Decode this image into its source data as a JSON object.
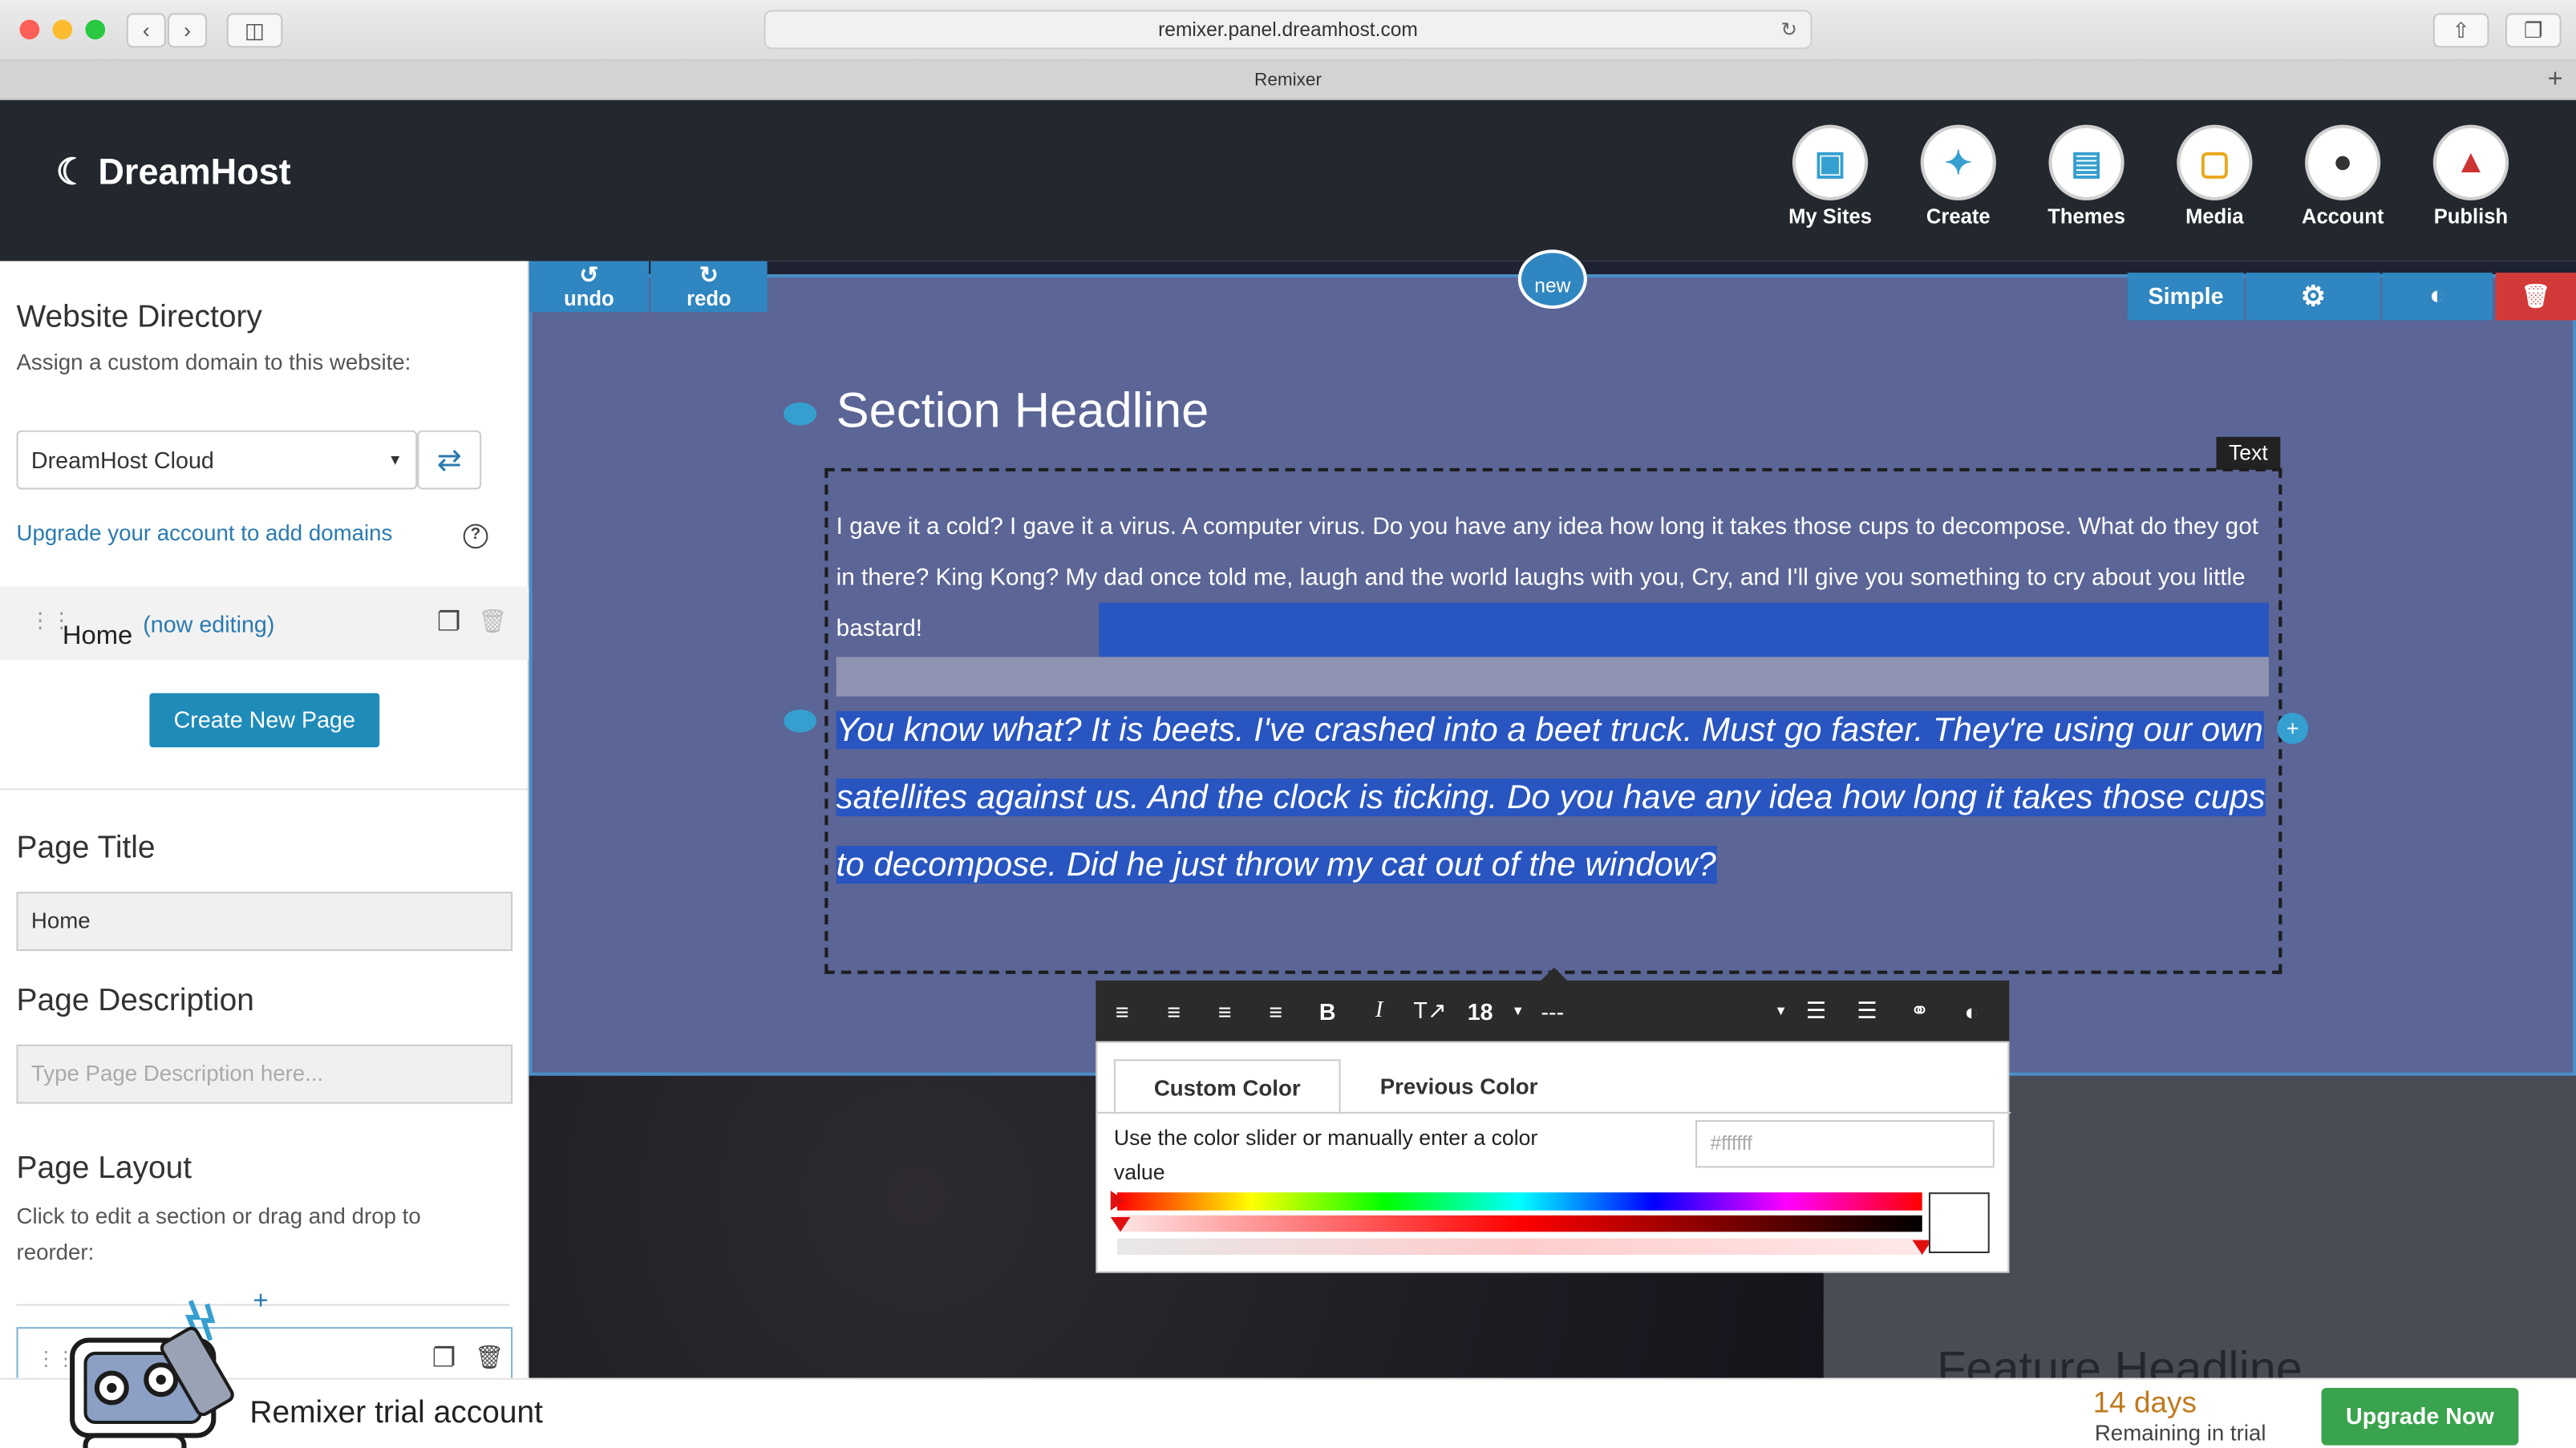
{
  "browser": {
    "url": "remixer.panel.dreamhost.com",
    "tab_title": "Remixer"
  },
  "brand": {
    "name": "DreamHost"
  },
  "nav": {
    "items": [
      {
        "label": "My Sites",
        "icon": "my-sites-icon"
      },
      {
        "label": "Create",
        "icon": "magic-wand-icon"
      },
      {
        "label": "Themes",
        "icon": "themes-icon"
      },
      {
        "label": "Media",
        "icon": "folder-icon"
      },
      {
        "label": "Account",
        "icon": "user-icon"
      },
      {
        "label": "Publish",
        "icon": "rocket-icon"
      }
    ]
  },
  "sidebar": {
    "directory_title": "Website Directory",
    "directory_subtitle": "Assign a custom domain to this website:",
    "domain_selected": "DreamHost Cloud",
    "upgrade_link": "Upgrade your account to add domains",
    "page_name": "Home",
    "page_status": "(now editing)",
    "create_page_label": "Create New Page",
    "page_title_heading": "Page Title",
    "page_title_value": "Home",
    "page_desc_heading": "Page Description",
    "page_desc_placeholder": "Type Page Description here...",
    "layout_heading": "Page Layout",
    "layout_help": "Click to edit a section or drag and drop to reorder:"
  },
  "editor": {
    "undo_label": "undo",
    "redo_label": "redo",
    "new_label": "new",
    "simple_label": "Simple",
    "section_headline": "Section Headline",
    "text_tag": "Text",
    "paragraph1": "I gave it a cold? I gave it a virus. A computer virus. Do you have any idea how long it takes those cups to decompose. What do they got in there? King Kong? My dad once told me, laugh and the world laughs with you, Cry, and I'll give you something to cry about you little bastard!",
    "paragraph2": "You know what? It is beets. I've crashed into a beet truck. Must go faster. They're using our own satellites against us. And the clock is ticking. Do you have any idea how long it takes those cups to decompose. Did he just throw my cat out of the window?",
    "feature_headline": "Feature Headline",
    "toolbar": {
      "font_size": "18",
      "style_value": "---"
    },
    "color_panel": {
      "tab_custom": "Custom Color",
      "tab_previous": "Previous Color",
      "help": "Use the color slider or manually enter a color value",
      "hex_placeholder": "#ffffff"
    }
  },
  "footer": {
    "trial_label": "Remixer trial account",
    "days": "14 days",
    "remaining": "Remaining in trial",
    "upgrade_label": "Upgrade Now"
  },
  "colors": {
    "header_bg": "#23272e",
    "accent": "#2f86c0",
    "section_bg": "#5b6596",
    "selection": "#2855c0",
    "upgrade_green": "#3aa34d"
  }
}
